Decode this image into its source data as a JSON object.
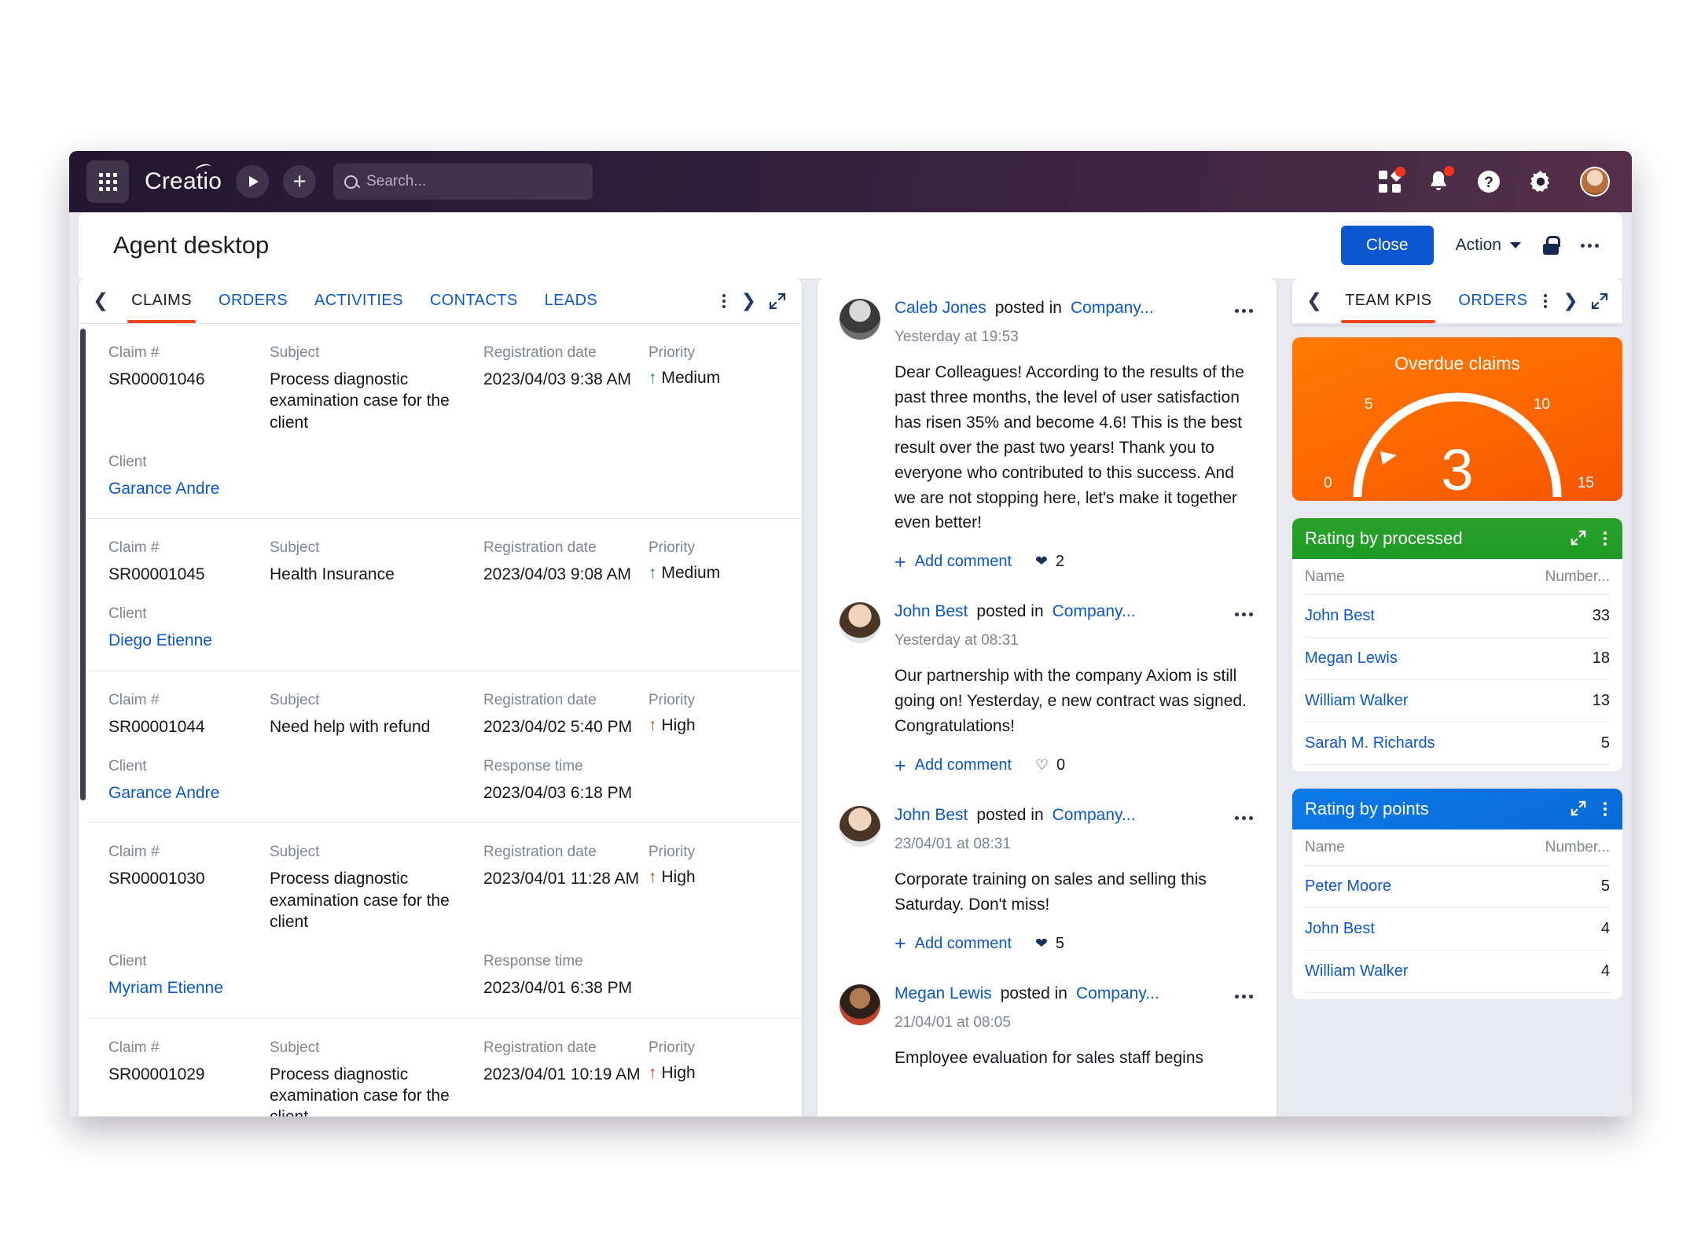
{
  "topbar": {
    "brand": "Creatio",
    "search_placeholder": "Search...",
    "search_value": ""
  },
  "page": {
    "title": "Agent desktop",
    "close_label": "Close",
    "action_label": "Action"
  },
  "left_panel": {
    "tabs": [
      {
        "label": "CLAIMS",
        "active": true
      },
      {
        "label": "ORDERS",
        "active": false
      },
      {
        "label": "ACTIVITIES",
        "active": false
      },
      {
        "label": "CONTACTS",
        "active": false
      },
      {
        "label": "LEADS",
        "active": false
      }
    ],
    "labels": {
      "claim": "Claim #",
      "subject": "Subject",
      "registration_date": "Registration date",
      "priority": "Priority",
      "client": "Client",
      "response_time": "Response time"
    },
    "rows": [
      {
        "claim": "SR00001046",
        "subject": "Process diagnostic examination case for the client",
        "registration_date": "2023/04/03 9:38 AM",
        "priority": "Medium",
        "priority_level": "medium",
        "client": "Garance Andre",
        "response_time": ""
      },
      {
        "claim": "SR00001045",
        "subject": "Health Insurance",
        "registration_date": "2023/04/03 9:08 AM",
        "priority": "Medium",
        "priority_level": "medium",
        "client": "Diego Etienne",
        "response_time": ""
      },
      {
        "claim": "SR00001044",
        "subject": "Need help with refund",
        "registration_date": "2023/04/02 5:40 PM",
        "priority": "High",
        "priority_level": "high",
        "client": "Garance Andre",
        "response_time": "2023/04/03 6:18 PM"
      },
      {
        "claim": "SR00001030",
        "subject": "Process diagnostic examination case for the client",
        "registration_date": "2023/04/01 11:28 AM",
        "priority": "High",
        "priority_level": "high",
        "client": "Myriam Etienne",
        "response_time": "2023/04/01 6:38 PM"
      },
      {
        "claim": "SR00001029",
        "subject": "Process diagnostic examination case for the client",
        "registration_date": "2023/04/01 10:19 AM",
        "priority": "High",
        "priority_level": "high",
        "client": "",
        "response_time": ""
      }
    ]
  },
  "feed": {
    "posted_in_label": "posted in",
    "add_comment_label": "Add comment",
    "posts": [
      {
        "author": "Caleb Jones",
        "channel": "Company...",
        "time": "Yesterday at 19:53",
        "body": "Dear Colleagues! According to the results of the past three months, the level of user satisfaction has risen 35% and become 4.6! This is the best result over the past two years! Thank you to everyone who contributed to this success. And we are not stopping here, let's make it together even better!",
        "likes": "2",
        "liked": true
      },
      {
        "author": "John Best",
        "channel": "Company...",
        "time": "Yesterday at 08:31",
        "body": "Our partnership with the company Axiom is still going on! Yesterday, e new contract was signed. Congratulations!",
        "likes": "0",
        "liked": false
      },
      {
        "author": "John Best",
        "channel": "Company...",
        "time": "23/04/01 at 08:31",
        "body": "Corporate training on sales and selling this Saturday. Don't miss!",
        "likes": "5",
        "liked": true
      },
      {
        "author": "Megan Lewis",
        "channel": "Company...",
        "time": "21/04/01 at 08:05",
        "body": "Employee evaluation for sales staff begins",
        "likes": "",
        "liked": false
      }
    ]
  },
  "right_panel": {
    "tabs": [
      {
        "label": "TEAM KPIS",
        "active": true
      },
      {
        "label": "ORDERS",
        "active": false
      }
    ],
    "gauge": {
      "title": "Overdue claims",
      "value": "3",
      "min_label": "0",
      "max_label": "15",
      "tick_5": "5",
      "tick_10": "10"
    },
    "rating_processed": {
      "title": "Rating by processed",
      "col_name": "Name",
      "col_number": "Number...",
      "rows": [
        {
          "name": "John Best",
          "value": "33"
        },
        {
          "name": "Megan Lewis",
          "value": "18"
        },
        {
          "name": "William Walker",
          "value": "13"
        },
        {
          "name": "Sarah M. Richards",
          "value": "5"
        }
      ]
    },
    "rating_points": {
      "title": "Rating by points",
      "col_name": "Name",
      "col_number": "Number...",
      "rows": [
        {
          "name": "Peter Moore",
          "value": "5"
        },
        {
          "name": "John Best",
          "value": "4"
        },
        {
          "name": "William Walker",
          "value": "4"
        }
      ]
    }
  },
  "chart_data": {
    "type": "gauge",
    "title": "Overdue claims",
    "value": 3,
    "min": 0,
    "max": 15,
    "ticks": [
      0,
      5,
      10,
      15
    ],
    "ylabel": "",
    "xlabel": ""
  },
  "colors": {
    "accent_blue": "#0b57d0",
    "tab_underline": "#f2471f",
    "gauge_orange": "#ff6a00",
    "green_header": "#1d9a23",
    "blue_header": "#0a6ad6",
    "priority_high": "#e8320e",
    "priority_medium": "#0a9a2e"
  }
}
